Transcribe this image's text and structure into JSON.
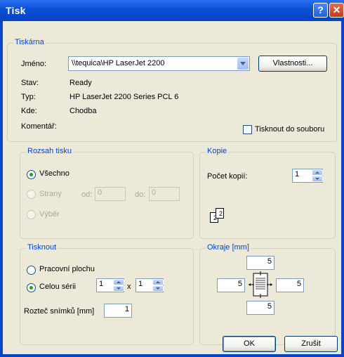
{
  "window": {
    "title": "Tisk",
    "help_glyph": "?",
    "close_glyph": "✕"
  },
  "printer": {
    "group_title": "Tiskárna",
    "name_label": "Jméno:",
    "name_value": "\\\\tequica\\HP LaserJet 2200",
    "properties_button": "Vlastnosti...",
    "status_label": "Stav:",
    "status_value": "Ready",
    "type_label": "Typ:",
    "type_value": "HP LaserJet 2200 Series PCL 6",
    "where_label": "Kde:",
    "where_value": "Chodba",
    "comment_label": "Komentář:",
    "print_to_file_label": "Tisknout do souboru",
    "print_to_file_checked": false
  },
  "range": {
    "group_title": "Rozsah tisku",
    "all_label": "Všechno",
    "pages_label": "Strany",
    "from_label": "od:",
    "from_value": "0",
    "to_label": "do:",
    "to_value": "0",
    "selection_label": "Výběr",
    "selected": "all"
  },
  "copies": {
    "group_title": "Kopie",
    "count_label": "Počet kopií:",
    "count_value": "1",
    "collate_icon_page_back": "2",
    "collate_icon_page_front": "2"
  },
  "print_mode": {
    "group_title": "Tisknout",
    "desktop_label": "Pracovní plochu",
    "series_label": "Celou sérii",
    "selected": "series",
    "cols_value": "1",
    "times_label": "x",
    "rows_value": "1",
    "spacing_label": "Rozteč snímků [mm]",
    "spacing_value": "1"
  },
  "margins": {
    "group_title": "Okraje [mm]",
    "top": "5",
    "left": "5",
    "right": "5",
    "bottom": "5"
  },
  "buttons": {
    "ok": "OK",
    "cancel": "Zrušit"
  }
}
